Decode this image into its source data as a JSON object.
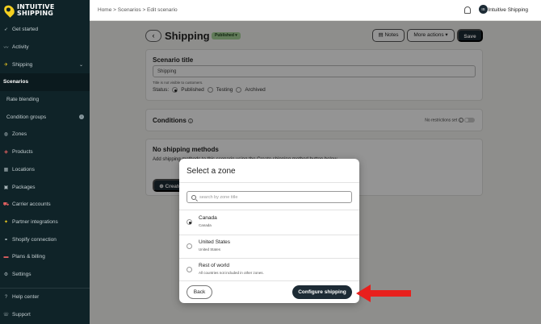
{
  "brand": {
    "line1": "INTUITIVE",
    "line2": "SHIPPING",
    "accent": "#f5d020"
  },
  "sidebar": {
    "items": [
      {
        "label": "Get started",
        "icon": "rocket-icon"
      },
      {
        "label": "Activity",
        "icon": "activity-icon"
      },
      {
        "label": "Shipping",
        "icon": "shipping-icon"
      },
      {
        "label": "Scenarios"
      },
      {
        "label": "Rate blending"
      },
      {
        "label": "Condition groups"
      },
      {
        "label": "Zones",
        "icon": "globe-icon"
      },
      {
        "label": "Products",
        "icon": "tag-icon"
      },
      {
        "label": "Locations",
        "icon": "building-icon"
      },
      {
        "label": "Packages",
        "icon": "box-icon"
      },
      {
        "label": "Carrier accounts",
        "icon": "truck-icon"
      },
      {
        "label": "Partner integrations",
        "icon": "handshake-icon"
      },
      {
        "label": "Shopify connection",
        "icon": "link-icon"
      },
      {
        "label": "Plans & billing",
        "icon": "card-icon"
      },
      {
        "label": "Settings",
        "icon": "gear-icon"
      },
      {
        "label": "Help center",
        "icon": "help-icon"
      },
      {
        "label": "Support",
        "icon": "support-icon"
      }
    ]
  },
  "topbar": {
    "breadcrumb": "Home > Scenarios > Edit scenario",
    "user_initials": "IS",
    "user_name": "Intuitive Shipping"
  },
  "header": {
    "back": "‹",
    "title": "Shipping",
    "status": "Published ▾",
    "notes": "Notes",
    "more_actions": "More actions ▾",
    "save": "Save"
  },
  "scenario": {
    "section_title": "Scenario title",
    "title_value": "Shipping",
    "hint": "Title is not visible to customers.",
    "status_label": "Status:",
    "statuses": [
      "Published",
      "Testing",
      "Archived"
    ],
    "selected_status": "Published"
  },
  "conditions": {
    "title": "Conditions",
    "restriction_label": "No restrictions set"
  },
  "methods": {
    "title": "No shipping methods",
    "desc": "Add shipping methods to this scenario using the Create shipping method button below.",
    "create_label": "Create"
  },
  "modal": {
    "title": "Select a zone",
    "search_placeholder": "search by zone title",
    "zones": [
      {
        "name": "Canada",
        "desc": "Canada",
        "selected": true
      },
      {
        "name": "United States",
        "desc": "United States",
        "selected": false
      },
      {
        "name": "Rest of world",
        "desc": "All countries not included in other zones.",
        "selected": false
      }
    ],
    "back_label": "Back",
    "configure_label": "Configure shipping"
  },
  "colors": {
    "sidebar_bg": "#0f2328",
    "primary_dark": "#1d2b35",
    "status_green": "#a7d59a",
    "annotation_red": "#e8201d"
  }
}
